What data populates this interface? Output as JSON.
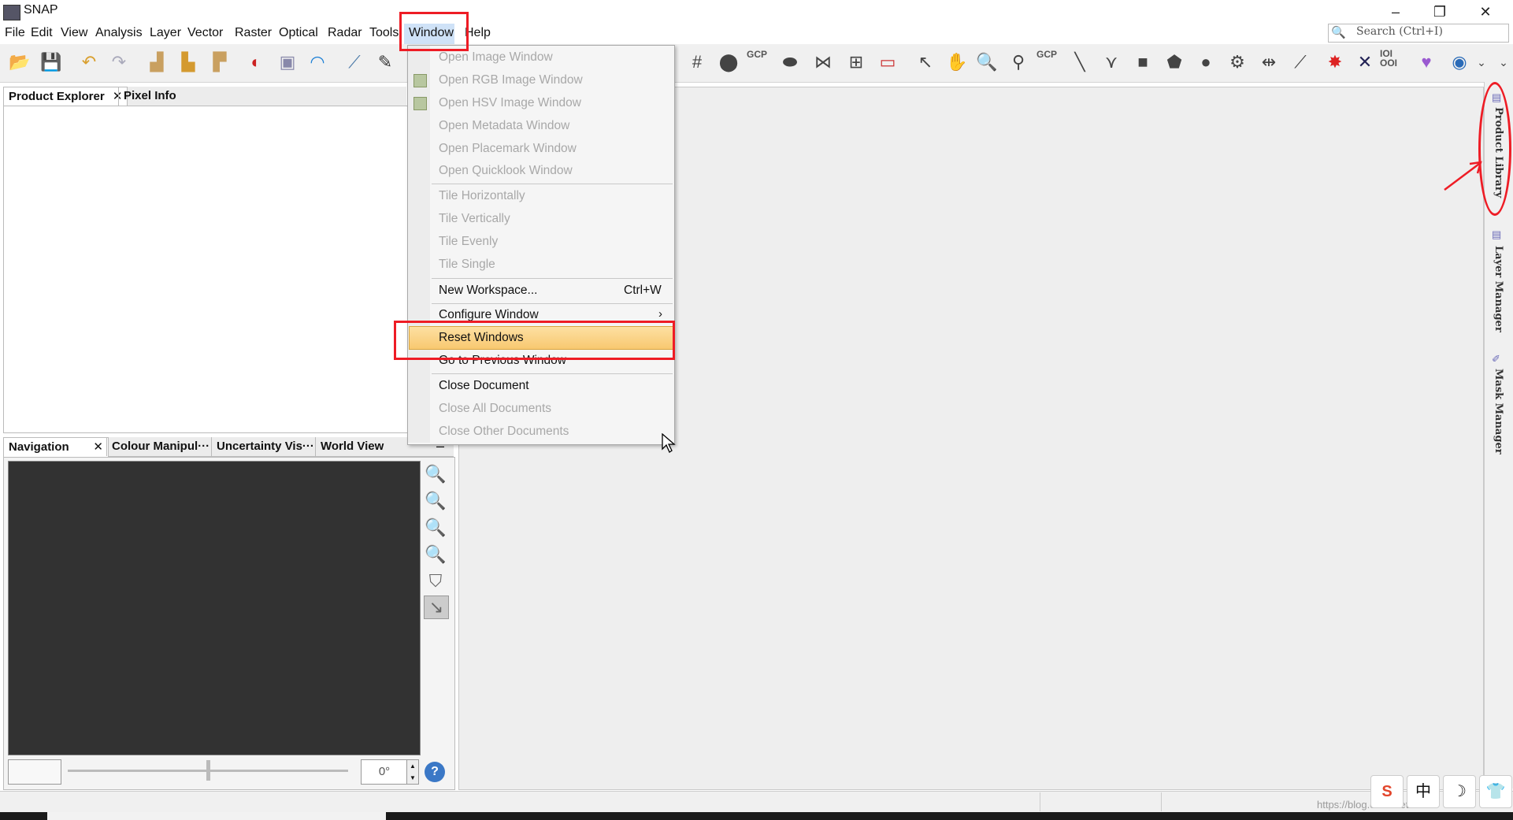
{
  "window": {
    "title": "SNAP",
    "controls": {
      "minimize": "–",
      "restore": "❐",
      "close": "✕"
    }
  },
  "menubar": {
    "items": [
      "File",
      "Edit",
      "View",
      "Analysis",
      "Layer",
      "Vector",
      "Raster",
      "Optical",
      "Radar",
      "Tools",
      "Window",
      "Help"
    ],
    "active": "Window"
  },
  "search": {
    "placeholder": "Search (Ctrl+I)"
  },
  "toolbar": {
    "gcp_label": "GCP",
    "binary_label": "IOI\nOOI"
  },
  "left_top_panel": {
    "tabs": [
      "Product Explorer",
      "Pixel Info"
    ]
  },
  "left_bottom_panel": {
    "tabs": [
      "Navigation",
      "Colour Manipul···",
      "Uncertainty Vis···",
      "World View"
    ],
    "rotation_value": "0°"
  },
  "window_menu": {
    "items": [
      {
        "label": "Open Image Window",
        "enabled": false,
        "icon": ""
      },
      {
        "label": "Open RGB Image Window",
        "enabled": false,
        "icon": "rgb-image-icon"
      },
      {
        "label": "Open HSV Image Window",
        "enabled": false,
        "icon": "hsv-image-icon"
      },
      {
        "label": "Open Metadata Window",
        "enabled": false,
        "icon": ""
      },
      {
        "label": "Open Placemark Window",
        "enabled": false,
        "icon": ""
      },
      {
        "label": "Open Quicklook Window",
        "enabled": false,
        "icon": ""
      },
      {
        "label": "Tile Horizontally",
        "enabled": false,
        "icon": ""
      },
      {
        "label": "Tile Vertically",
        "enabled": false,
        "icon": ""
      },
      {
        "label": "Tile Evenly",
        "enabled": false,
        "icon": ""
      },
      {
        "label": "Tile Single",
        "enabled": false,
        "icon": ""
      },
      {
        "label": "New Workspace...",
        "enabled": true,
        "shortcut": "Ctrl+W"
      },
      {
        "label": "Configure Window",
        "enabled": true,
        "submenu": "›"
      },
      {
        "label": "Reset Windows",
        "enabled": true,
        "highlighted": true
      },
      {
        "label": "Go to Previous Window",
        "enabled": true
      },
      {
        "label": "Close Document",
        "enabled": true
      },
      {
        "label": "Close All Documents",
        "enabled": false
      },
      {
        "label": "Close Other Documents",
        "enabled": false
      }
    ]
  },
  "side_strip": {
    "labels": [
      "Product Library",
      "Layer Manager",
      "Mask Manager"
    ]
  },
  "tray": [
    "S",
    "中",
    "☽",
    "👕"
  ],
  "watermark": "https://blog.csdn.net/..."
}
